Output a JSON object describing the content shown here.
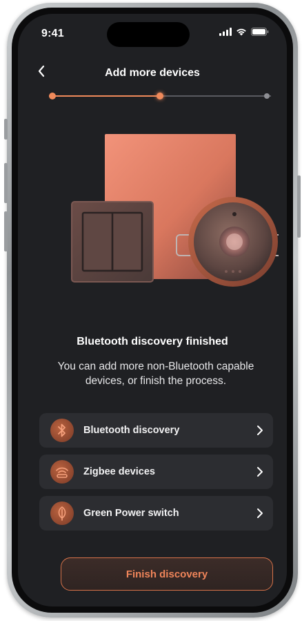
{
  "status": {
    "time": "9:41"
  },
  "header": {
    "title": "Add more devices"
  },
  "progress": {
    "current_step": 2,
    "total_steps": 3,
    "fraction_complete": 0.5
  },
  "main": {
    "headline": "Bluetooth discovery finished",
    "description": "You can add more non-Bluetooth capable devices, or finish the process."
  },
  "options": [
    {
      "label": "Bluetooth discovery",
      "icon": "bluetooth-icon"
    },
    {
      "label": "Zigbee devices",
      "icon": "zigbee-icon"
    },
    {
      "label": "Green Power switch",
      "icon": "leaf-icon"
    }
  ],
  "actions": {
    "finish_label": "Finish discovery"
  },
  "colors": {
    "accent": "#f08a5b",
    "background": "#1f2023",
    "card": "#2c2d31"
  }
}
